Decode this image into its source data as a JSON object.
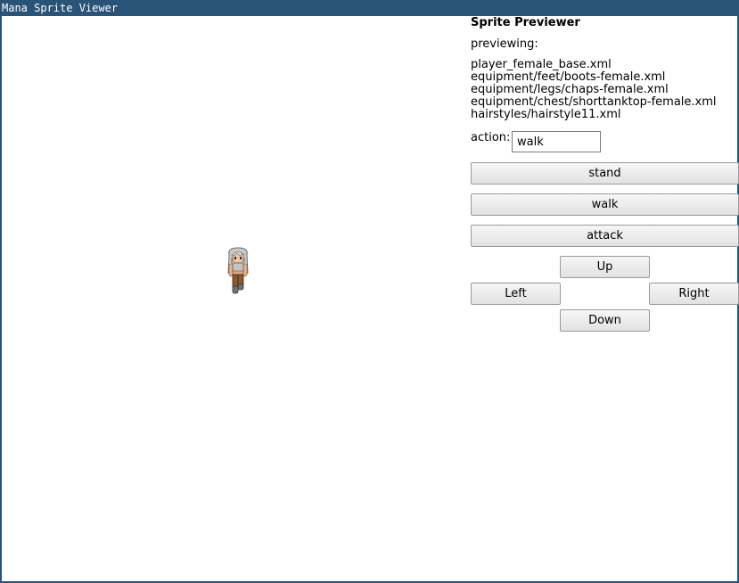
{
  "window": {
    "title": "Mana Sprite Viewer"
  },
  "panel": {
    "heading": "Sprite Previewer",
    "previewing_label": "previewing:",
    "files": [
      "player_female_base.xml",
      "equipment/feet/boots-female.xml",
      "equipment/legs/chaps-female.xml",
      "equipment/chest/shorttanktop-female.xml",
      "hairstyles/hairstyle11.xml"
    ],
    "action_label": "action:",
    "action_value": "walk",
    "buttons": {
      "stand": "stand",
      "walk": "walk",
      "attack": "attack",
      "up": "Up",
      "left": "Left",
      "right": "Right",
      "down": "Down"
    }
  },
  "canvas": {
    "sprite": "player-sprite-icon",
    "direction": "Down"
  },
  "colors": {
    "titlebar": "#2a5378",
    "background": "#ffffff"
  }
}
